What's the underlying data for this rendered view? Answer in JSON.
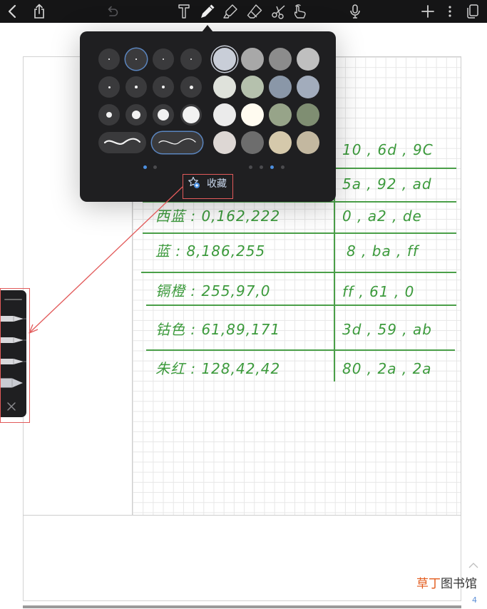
{
  "toolbar": {
    "icons": [
      "chevron-left-icon",
      "share-icon",
      "undo-icon",
      "text-tool-icon",
      "pen-tool-icon",
      "highlighter-tool-icon",
      "eraser-tool-icon",
      "lasso-tool-icon",
      "hand-tool-icon",
      "microphone-icon",
      "plus-icon",
      "more-icon",
      "pages-icon"
    ],
    "selected_tool": "pen-tool-icon"
  },
  "popup": {
    "swatches": [
      "#c9ced8",
      "#a8a8a8",
      "#8c8c8c",
      "#bfbfbf",
      "#dfe2db",
      "#b5c1ad",
      "#8a97a8",
      "#a2acbc",
      "#ebebeb",
      "#fffbf0",
      "#97a489",
      "#7f8e72",
      "#ddd7d4",
      "#6d6d6d",
      "#d5c9ab",
      "#c3b8a0"
    ],
    "selected_color": "#c9ced8",
    "accent": "#4c8fe0",
    "favorites_label": "收藏"
  },
  "table": {
    "ink_color": "#3c9a3c",
    "rows": [
      {
        "right": "10 , 6d , 9C"
      },
      {
        "right": "5a , 92 , ad"
      },
      {
        "left": "西蓝 : 0,162,222",
        "right": "0 , a2 , de"
      },
      {
        "left": "蓝 : 8,186,255",
        "right": "8 , ba , ff"
      },
      {
        "left": "镉橙 : 255,97,0",
        "right": "ff , 61 , 0"
      },
      {
        "left": "钴色 : 61,89,171",
        "right": "3d , 59 , ab"
      },
      {
        "left": "朱红 : 128,42,42",
        "right": "80 , 2a , 2a"
      }
    ]
  },
  "watermark": {
    "text_1": "草丁",
    "text_2": "图书馆",
    "color_1": "#e35d1f",
    "color_2": "#333333"
  },
  "page_indicator": {
    "page": "4"
  }
}
